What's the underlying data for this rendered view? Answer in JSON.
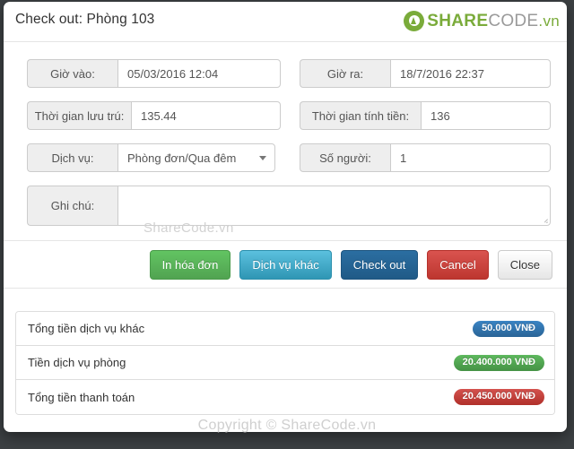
{
  "header": {
    "title": "Check out: Phòng 103",
    "brand": {
      "icon": "recycle-logo-icon",
      "part1": "SHARE",
      "part2": "CODE",
      "part3": ".vn",
      "color_green": "#7aab3a",
      "color_gray": "#9a9a9a"
    }
  },
  "form": {
    "checkin": {
      "label": "Giờ vào:",
      "value": "05/03/2016 12:04",
      "placeholder": ""
    },
    "checkout": {
      "label": "Giờ ra:",
      "value": "18/7/2016 22:37",
      "placeholder": ""
    },
    "duration": {
      "label": "Thời gian lưu trú:",
      "value": "135.44",
      "placeholder": ""
    },
    "billable": {
      "label": "Thời gian tính tiền:",
      "value": "136",
      "placeholder": ""
    },
    "service": {
      "label": "Dịch vụ:",
      "value": "Phòng đơn/Qua đêm",
      "options": [
        "Phòng đơn/Qua đêm"
      ]
    },
    "guests": {
      "label": "Số người:",
      "value": "1",
      "placeholder": ""
    },
    "note": {
      "label": "Ghi chú:",
      "value": "",
      "placeholder": ""
    }
  },
  "buttons": {
    "print_invoice": "In hóa đơn",
    "other_service": "Dịch vụ khác",
    "check_out": "Check out",
    "cancel": "Cancel",
    "close": "Close"
  },
  "totals": {
    "rows": [
      {
        "label": "Tổng tiền dịch vụ khác",
        "amount": "50.000 VNĐ",
        "color": "#2a6496"
      },
      {
        "label": "Tiền dịch vụ phòng",
        "amount": "20.400.000 VNĐ",
        "color": "#459245"
      },
      {
        "label": "Tổng tiền thanh toán",
        "amount": "20.450.000 VNĐ",
        "color": "#b0302a"
      }
    ]
  },
  "watermarks": {
    "middle": "ShareCode.vn",
    "bottom": "Copyright © ShareCode.vn"
  }
}
